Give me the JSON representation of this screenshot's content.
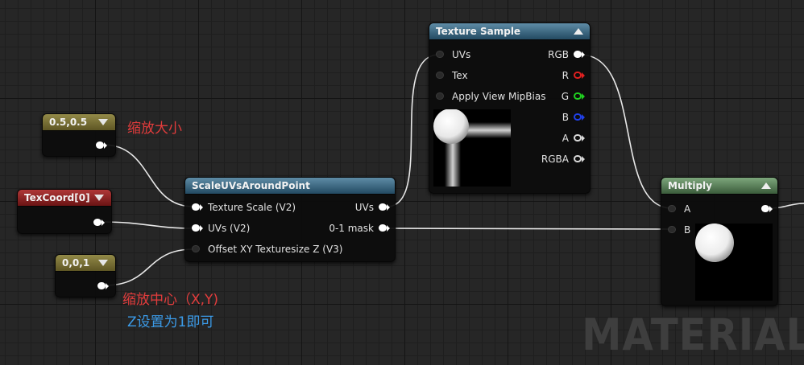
{
  "nodes": {
    "const2": {
      "title": "0.5,0.5"
    },
    "texcoord": {
      "title": "TexCoord[0]"
    },
    "const3": {
      "title": "0,0,1"
    },
    "scale_uvs": {
      "title": "ScaleUVsAroundPoint",
      "inputs": [
        "Texture Scale (V2)",
        "UVs (V2)",
        "Offset XY Texturesize Z (V3)"
      ],
      "outputs": [
        "UVs",
        "0-1 mask"
      ]
    },
    "texture_sample": {
      "title": "Texture Sample",
      "inputs": [
        "UVs",
        "Tex",
        "Apply View MipBias"
      ],
      "outputs": [
        "RGB",
        "R",
        "G",
        "B",
        "A",
        "RGBA"
      ]
    },
    "multiply": {
      "title": "Multiply",
      "inputs": [
        "A",
        "B"
      ]
    }
  },
  "annotations": {
    "scale_size": "缩放大小",
    "scale_center": "缩放中心（X,Y)",
    "z_note": "Z设置为1即可"
  },
  "watermark": "MATERIAL",
  "colors": {
    "annotation_red": "#e23c3c",
    "annotation_blue": "#3b9be8",
    "pin_r": "#e02020",
    "pin_g": "#20d020",
    "pin_b": "#2040e8",
    "pin_white": "#ffffff",
    "header_blue": "#3d6985",
    "header_green": "#5c845c",
    "header_olive": "#7d7436",
    "header_red": "#8e2222"
  },
  "icons": [
    "collapse-caret-icon",
    "dropdown-caret-icon",
    "pin-icon"
  ]
}
